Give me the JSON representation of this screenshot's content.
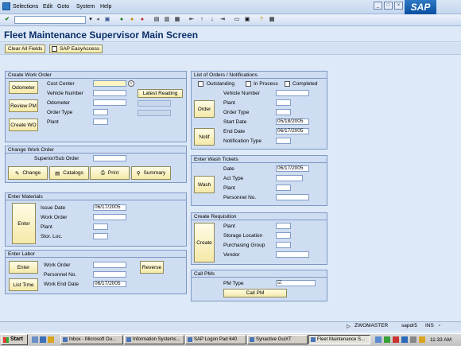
{
  "menu": {
    "items": [
      "Selections",
      "Edit",
      "Goto",
      "System",
      "Help"
    ],
    "sap_logo": "SAP"
  },
  "toolbar": {
    "icons": [
      "check-icon",
      "save-icon",
      "back-icon",
      "exit-icon",
      "cancel-icon",
      "print-icon",
      "find-icon",
      "find-next-icon",
      "first-page-icon",
      "prev-page-icon",
      "next-page-icon",
      "last-page-icon",
      "new-session-icon",
      "shortcut-icon",
      "help-icon",
      "layout-icon"
    ]
  },
  "page": {
    "title": "Fleet Maintenance Supervisor Main Screen"
  },
  "app_toolbar": {
    "clear_all": "Clear All Fields",
    "easy_access": "SAP EasyAccess"
  },
  "create_work_order": {
    "title": "Create Work Order",
    "btn_odometer": "Odometer",
    "btn_review_pm": "Review PM",
    "btn_create_wo": "Create WO",
    "btn_latest_reading": "Latest Reading",
    "lbl_cost_center": "Cost Center",
    "lbl_vehicle_number": "Vehicle Number",
    "lbl_odometer": "Odometer",
    "lbl_order_type": "Order Type",
    "lbl_plant": "Plant"
  },
  "change_work_order": {
    "title": "Change Work Order",
    "lbl_superior": "Superior/Sub Order",
    "btn_change": "Change",
    "btn_catalogs": "Catalogs",
    "btn_print": "Print",
    "btn_summary": "Summary"
  },
  "enter_materials": {
    "title": "Enter Materials",
    "btn_enter": "Enter",
    "lbl_issue_date": "Issue Date",
    "val_issue_date": "06/17/2005",
    "lbl_work_order": "Work Order",
    "lbl_plant": "Plant",
    "lbl_stor_loc": "Stor. Loc."
  },
  "enter_labor": {
    "title": "Enter Labor",
    "btn_enter": "Enter",
    "btn_list_time": "List Time",
    "btn_reverse": "Reverse",
    "lbl_work_order": "Work Order",
    "lbl_personnel": "Personnel No.",
    "lbl_work_end_date": "Work End Date",
    "val_work_end_date": "06/17/2005"
  },
  "orders_list": {
    "title": "List of Orders / Notifications",
    "chk_outstanding": "Outstanding",
    "chk_in_process": "In Process",
    "chk_completed": "Completed",
    "btn_order": "Order",
    "btn_notif": "Notif",
    "lbl_vehicle_number": "Vehicle Number",
    "lbl_plant": "Plant",
    "lbl_order_type": "Order Type",
    "lbl_start_date": "Start Date",
    "val_start_date": "05/18/2005",
    "lbl_end_date": "End Date",
    "val_end_date": "06/17/2005",
    "lbl_notification_type": "Notification Type"
  },
  "wash_tickets": {
    "title": "Enter Wash Tickets",
    "btn_wash": "Wash",
    "lbl_date": "Date",
    "val_date": "06/17/2005",
    "lbl_act_type": "Act Type",
    "lbl_plant": "Plant",
    "lbl_personnel": "Personnel No."
  },
  "create_requisition": {
    "title": "Create Requisition",
    "btn_create": "Create",
    "lbl_plant": "Plant",
    "lbl_storage_location": "Storage Location",
    "lbl_purchasing_group": "Purchasing Group",
    "lbl_vendor": "Vendor"
  },
  "call_pms": {
    "title": "Call PMs",
    "lbl_pm_type": "PM Type",
    "btn_call_pm": "Call PM"
  },
  "status_bar": {
    "system": "ZWOMASTER",
    "server": "sapdr5",
    "mode": "INS"
  },
  "taskbar": {
    "start": "Start",
    "tasks": [
      "Inbox - Microsoft Ou...",
      "Information Systems...",
      "SAP Logon Pad 640",
      "Synactive GuiXT",
      "Fleet Maintenance S..."
    ],
    "clock": "11:33 AM"
  }
}
